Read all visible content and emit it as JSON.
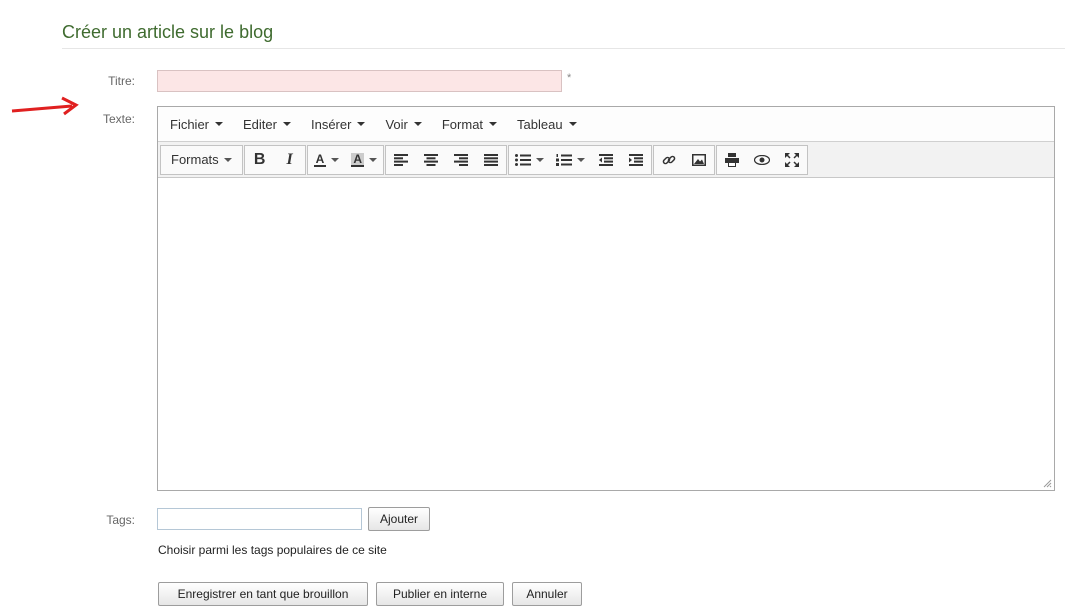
{
  "page": {
    "title": "Créer un article sur le blog"
  },
  "form": {
    "title_label": "Titre:",
    "title_value": "",
    "required_mark": "*",
    "text_label": "Texte:",
    "tags_label": "Tags:",
    "tags_value": "",
    "add_tag_button": "Ajouter",
    "popular_tags_link": "Choisir parmi les tags populaires de ce site",
    "save_draft_button": "Enregistrer en tant que brouillon",
    "publish_button": "Publier en interne",
    "cancel_button": "Annuler"
  },
  "editor": {
    "menu": [
      "Fichier",
      "Editer",
      "Insérer",
      "Voir",
      "Format",
      "Tableau"
    ],
    "formats_label": "Formats",
    "bold_label": "B",
    "italic_label": "I",
    "text_color_label": "A",
    "bg_color_label": "A",
    "content": ""
  },
  "colors": {
    "title_green": "#3f6b2f",
    "title_field_bg": "#fce6e6",
    "arrow_red": "#e02020"
  },
  "icons": [
    "arrow-annotation-icon",
    "align-left-icon",
    "align-center-icon",
    "align-right-icon",
    "align-justify-icon",
    "bullet-list-icon",
    "numbered-list-icon",
    "outdent-icon",
    "indent-icon",
    "link-icon",
    "image-icon",
    "print-icon",
    "preview-icon",
    "fullscreen-icon",
    "resize-grip-icon"
  ]
}
